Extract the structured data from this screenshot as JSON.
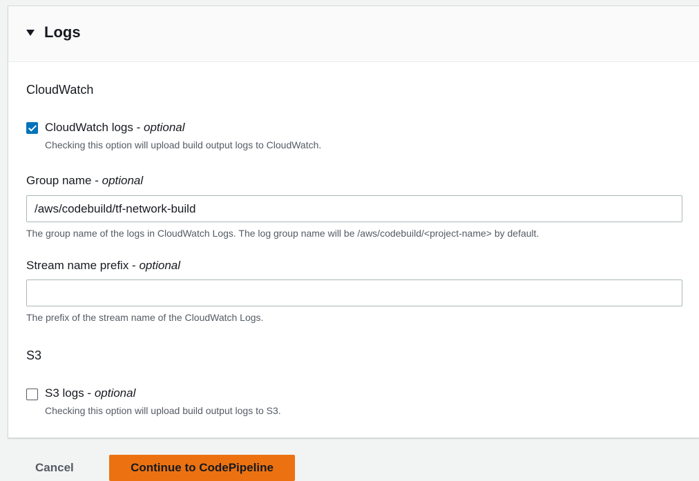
{
  "panel": {
    "title": "Logs",
    "collapse_icon": "caret-down-icon"
  },
  "cloudwatch": {
    "section_label": "CloudWatch",
    "checkbox": {
      "label": "CloudWatch logs - ",
      "optional": "optional",
      "checked": true,
      "description": "Checking this option will upload build output logs to CloudWatch."
    },
    "group_name": {
      "label": "Group name - ",
      "optional": "optional",
      "value": "/aws/codebuild/tf-network-build",
      "description": "The group name of the logs in CloudWatch Logs. The log group name will be /aws/codebuild/<project-name> by default."
    },
    "stream_prefix": {
      "label": "Stream name prefix - ",
      "optional": "optional",
      "value": "",
      "description": "The prefix of the stream name of the CloudWatch Logs."
    }
  },
  "s3": {
    "section_label": "S3",
    "checkbox": {
      "label": "S3 logs - ",
      "optional": "optional",
      "checked": false,
      "description": "Checking this option will upload build output logs to S3."
    }
  },
  "footer": {
    "cancel_label": "Cancel",
    "continue_label": "Continue to CodePipeline"
  },
  "colors": {
    "primary_button": "#ec7211",
    "checkbox_checked": "#0073bb"
  }
}
